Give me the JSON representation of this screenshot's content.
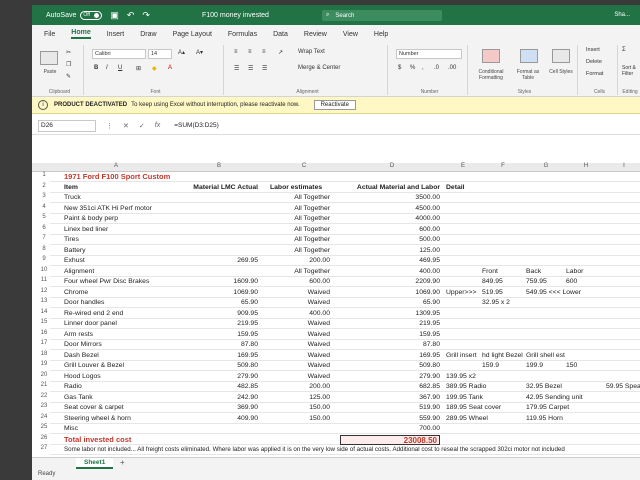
{
  "titlebar": {
    "autosave": "AutoSave",
    "toggle": "Off",
    "filename": "F100 money invested",
    "search": "Search",
    "user": "Sha..."
  },
  "tabs": [
    "File",
    "Home",
    "Insert",
    "Draw",
    "Page Layout",
    "Formulas",
    "Data",
    "Review",
    "View",
    "Help"
  ],
  "ribbon": {
    "font_name": "Calibri",
    "font_size": "14",
    "wrap_text": "Wrap Text",
    "merge_center": "Merge & Center",
    "number_format": "Number",
    "conditional": "Conditional Formatting",
    "format_table": "Format as Table",
    "cell_styles": "Cell Styles",
    "insert": "Insert",
    "delete": "Delete",
    "format": "Format",
    "sort_filter": "Sort & Filter",
    "groups": {
      "clipboard": "Clipboard",
      "font": "Font",
      "alignment": "Alignment",
      "number": "Number",
      "styles": "Styles",
      "cells": "Cells",
      "editing": "Editing"
    },
    "paste": "Paste"
  },
  "message": {
    "title": "PRODUCT DEACTIVATED",
    "text": "To keep using Excel without interruption, please reactivate now.",
    "button": "Reactivate"
  },
  "formula_bar": {
    "cell": "D26",
    "formula": "=SUM(D3:D25)"
  },
  "columns": [
    "A",
    "B",
    "C",
    "D",
    "E",
    "F",
    "G",
    "H",
    "I",
    "J"
  ],
  "rows": [
    {
      "n": "1",
      "a": "1971 Ford F100 Sport Custom",
      "b": "",
      "c": "",
      "d": "",
      "e": "",
      "style": "title"
    },
    {
      "n": "2",
      "a": "Item",
      "b": "Material LMC Actual",
      "c": "Labor estimates",
      "d": "Actual Material and Labor",
      "e": "Detail",
      "style": "header"
    },
    {
      "n": "3",
      "a": "Truck",
      "b": "",
      "c": "All Together",
      "d": "3500.00",
      "e": ""
    },
    {
      "n": "4",
      "a": "New 351ci ATK Hi Perf motor",
      "b": "",
      "c": "All Together",
      "d": "4500.00",
      "e": ""
    },
    {
      "n": "5",
      "a": "Paint & body perp",
      "b": "",
      "c": "All Together",
      "d": "4000.00",
      "e": ""
    },
    {
      "n": "6",
      "a": "Linex bed liner",
      "b": "",
      "c": "All Together",
      "d": "600.00",
      "e": ""
    },
    {
      "n": "7",
      "a": "Tires",
      "b": "",
      "c": "All Together",
      "d": "500.00",
      "e": ""
    },
    {
      "n": "8",
      "a": "Battery",
      "b": "",
      "c": "All Together",
      "d": "125.00",
      "e": ""
    },
    {
      "n": "9",
      "a": "Exhust",
      "b": "269.95",
      "c": "200.00",
      "d": "469.95",
      "e": ""
    },
    {
      "n": "10",
      "a": "Alignment",
      "b": "",
      "c": "All Together",
      "d": "400.00",
      "e": ""
    },
    {
      "n": "11",
      "a": "Four wheel Pwr Disc Brakes",
      "b": "1609.90",
      "c": "600.00",
      "d": "2209.90",
      "e": ""
    },
    {
      "n": "12",
      "a": "Chrome",
      "b": "1069.90",
      "c": "Waived",
      "d": "1069.90",
      "e": "Upper>>>"
    },
    {
      "n": "13",
      "a": "Door handles",
      "b": "65.90",
      "c": "Waived",
      "d": "65.90",
      "e": ""
    },
    {
      "n": "14",
      "a": "Re-wired end 2 end",
      "b": "909.95",
      "c": "400.00",
      "d": "1309.95",
      "e": ""
    },
    {
      "n": "15",
      "a": "Linner door panel",
      "b": "219.95",
      "c": "Waived",
      "d": "219.95",
      "e": ""
    },
    {
      "n": "16",
      "a": "Arm rests",
      "b": "159.95",
      "c": "Waived",
      "d": "159.95",
      "e": ""
    },
    {
      "n": "17",
      "a": "Door Mirrors",
      "b": "87.80",
      "c": "Waived",
      "d": "87.80",
      "e": ""
    },
    {
      "n": "18",
      "a": "Dash Bezel",
      "b": "169.95",
      "c": "Waived",
      "d": "169.95",
      "e": "Grill insert"
    },
    {
      "n": "19",
      "a": "Grill Louver & Bezel",
      "b": "509.80",
      "c": "Waived",
      "d": "509.80",
      "e": ""
    },
    {
      "n": "20",
      "a": "Hood Logos",
      "b": "279.90",
      "c": "Waived",
      "d": "279.90",
      "e": ""
    },
    {
      "n": "21",
      "a": "Radio",
      "b": "482.85",
      "c": "200.00",
      "d": "682.85",
      "e": ""
    },
    {
      "n": "22",
      "a": "Gas Tank",
      "b": "242.90",
      "c": "125.00",
      "d": "367.90",
      "e": ""
    },
    {
      "n": "23",
      "a": "Seat cover & carpet",
      "b": "369.90",
      "c": "150.00",
      "d": "519.90",
      "e": ""
    },
    {
      "n": "24",
      "a": "Steering wheel & horn",
      "b": "409.90",
      "c": "150.00",
      "d": "559.90",
      "e": ""
    },
    {
      "n": "25",
      "a": "Misc",
      "b": "",
      "c": "",
      "d": "700.00",
      "e": ""
    },
    {
      "n": "26",
      "a": "Total invested cost",
      "b": "",
      "c": "",
      "d": "23008.50",
      "e": "",
      "style": "total"
    },
    {
      "n": "27",
      "a": "Some labor not included... All freight costs eliminated. Where labor was applied it is on the very low side of actual costs. Additional cost to reseal the scrapped 302ci motor not included",
      "b": "",
      "c": "",
      "d": "",
      "e": "",
      "style": "note"
    }
  ],
  "side_notes": [
    {
      "row": 10,
      "col": "f",
      "text": "Front"
    },
    {
      "row": 10,
      "col": "g",
      "text": "Back"
    },
    {
      "row": 10,
      "col": "h",
      "text": "Labor"
    },
    {
      "row": 11,
      "col": "f",
      "text": "849.95"
    },
    {
      "row": 11,
      "col": "g",
      "text": "759.95"
    },
    {
      "row": 11,
      "col": "h",
      "text": "600"
    },
    {
      "row": 12,
      "col": "f",
      "text": "519.95"
    },
    {
      "row": 12,
      "col": "g",
      "text": "549.95 <<< Lower"
    },
    {
      "row": 13,
      "col": "f",
      "text": "32.95 x 2"
    },
    {
      "row": 18,
      "col": "f",
      "text": "hd light Bezel"
    },
    {
      "row": 18,
      "col": "g",
      "text": "Grill shell est"
    },
    {
      "row": 19,
      "col": "f",
      "text": "159.9"
    },
    {
      "row": 19,
      "col": "g",
      "text": "199.9"
    },
    {
      "row": 19,
      "col": "h",
      "text": "150"
    },
    {
      "row": 20,
      "col": "e",
      "text": "139.95 x2"
    },
    {
      "row": 21,
      "col": "e",
      "text": "389.95 Radio"
    },
    {
      "row": 21,
      "col": "g",
      "text": "32.95 Bezel"
    },
    {
      "row": 21,
      "col": "i",
      "text": "59.95 Speaker"
    },
    {
      "row": 22,
      "col": "e",
      "text": "199.95 Tank"
    },
    {
      "row": 22,
      "col": "g",
      "text": "42.95 Sending unit"
    },
    {
      "row": 23,
      "col": "e",
      "text": "189.95 Seat cover"
    },
    {
      "row": 23,
      "col": "g",
      "text": "179.95 Carpet"
    },
    {
      "row": 24,
      "col": "e",
      "text": "289.95 Wheel"
    },
    {
      "row": 24,
      "col": "g",
      "text": "119.95 Horn"
    }
  ],
  "sheet": {
    "name": "Sheet1",
    "add": "+"
  },
  "status": "Ready",
  "colors": {
    "excel_green": "#217346",
    "total_red": "#c0392b",
    "message_bg": "#fff8c5"
  }
}
